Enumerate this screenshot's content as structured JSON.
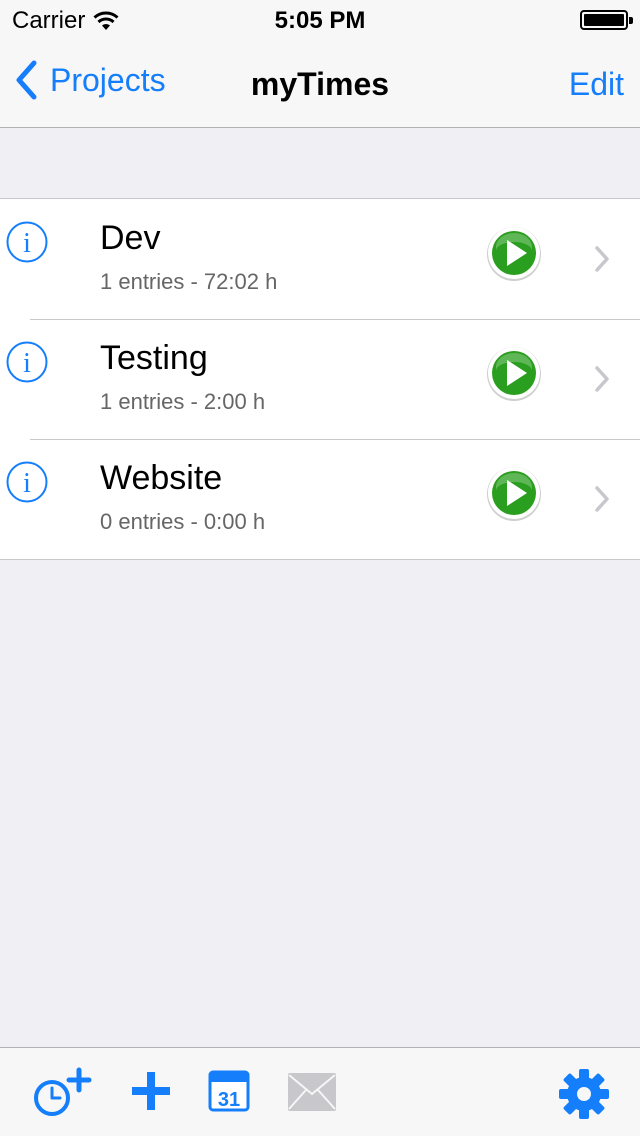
{
  "status_bar": {
    "carrier": "Carrier",
    "time": "5:05 PM"
  },
  "nav": {
    "back_label": "Projects",
    "title": "myTimes",
    "edit_label": "Edit"
  },
  "projects": [
    {
      "name": "Dev",
      "summary": "1 entries - 72:02 h"
    },
    {
      "name": "Testing",
      "summary": "1 entries - 2:00 h"
    },
    {
      "name": "Website",
      "summary": "0 entries - 0:00 h"
    }
  ],
  "toolbar": {
    "calendar_day": "31",
    "icons": [
      "add-timer-icon",
      "plus-icon",
      "calendar-icon",
      "mail-icon",
      "gear-icon"
    ]
  },
  "colors": {
    "tint": "#157efb",
    "play_green": "#2a9e1e",
    "disabled": "#c7c7cc"
  }
}
